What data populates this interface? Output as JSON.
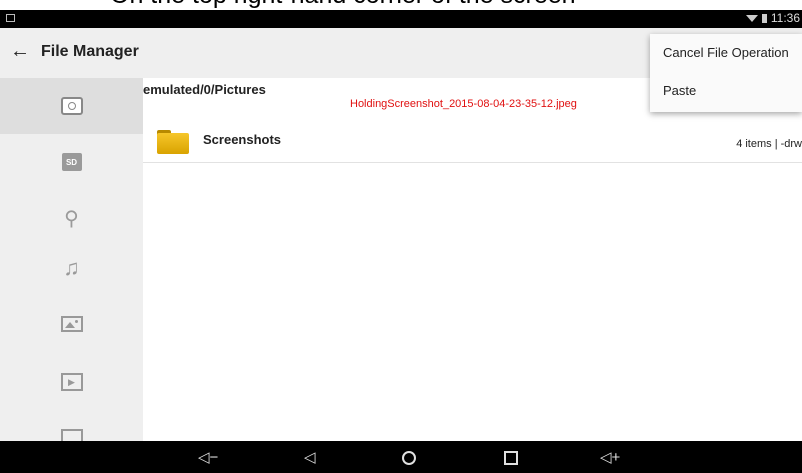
{
  "caption": "On the top right-hand corner of the screen",
  "status_bar": {
    "time": "11:36"
  },
  "app_bar": {
    "title": "File Manager"
  },
  "sidebar": {
    "items": [
      {
        "icon": "internal-storage-icon",
        "active": true
      },
      {
        "icon": "sd-card-icon",
        "label": "SD"
      },
      {
        "icon": "usb-icon"
      },
      {
        "icon": "music-icon"
      },
      {
        "icon": "pictures-icon"
      },
      {
        "icon": "video-icon"
      },
      {
        "icon": "book-icon"
      }
    ]
  },
  "main": {
    "path": "emulated/0/Pictures",
    "screenshot_filename": "HoldingScreenshot_2015-08-04-23-35-12.jpeg",
    "files": [
      {
        "name": "Screenshots",
        "meta": "4 items | -drw"
      }
    ]
  },
  "menu": {
    "items": [
      "Cancel File Operation",
      "Paste"
    ]
  },
  "nav_bar": {
    "vol_down": "◁−",
    "vol_up": "◁+"
  },
  "colors": {
    "accent_red": "#e01010",
    "folder": "#f6c62a"
  }
}
